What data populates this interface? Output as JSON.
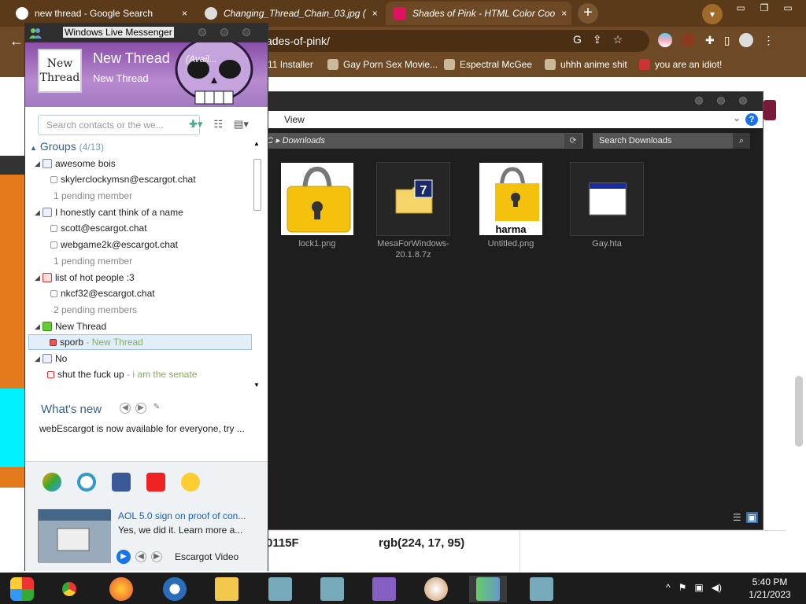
{
  "chrome": {
    "tabs": [
      {
        "title": "new thread - Google Search",
        "close": "×"
      },
      {
        "title": "Changing_Thread_Chain_03.jpg (",
        "close": "×"
      },
      {
        "title": "Shades of Pink - HTML Color Coo",
        "close": "×"
      }
    ],
    "new_tab": "+",
    "url": "ades-of-pink/",
    "bookmarks": [
      "11 Installer",
      "Gay Porn Sex Movie...",
      "Espectral McGee",
      "uhhh anime shit",
      "you are an idiot!"
    ]
  },
  "page": {
    "hex_value": "0115F",
    "rgb_value": "rgb(224, 17, 95)"
  },
  "explorer": {
    "menu_view": "View",
    "address": "C ▸ Downloads",
    "search_placeholder": "Search Downloads",
    "help": "?",
    "files": [
      {
        "name": "lock1.png"
      },
      {
        "name": "MesaForWindows-20.1.8.7z"
      },
      {
        "name": "Untitled.png",
        "thumb_text": "harma"
      },
      {
        "name": "Gay.hta"
      }
    ]
  },
  "messenger": {
    "window_title": "Windows Live Messenger",
    "avatar_text": "New Thread",
    "display_name": "New Thread",
    "status": "(Avail...",
    "personal_message": "New Thread",
    "search_placeholder": "Search contacts or the we...",
    "groups_label": "Groups",
    "groups_count": "(4/13)",
    "list": [
      {
        "type": "group",
        "label": "awesome bois"
      },
      {
        "type": "contact",
        "label": "skylerclockymsn@escargot.chat"
      },
      {
        "type": "pending",
        "label": "1 pending member"
      },
      {
        "type": "group",
        "label": "I honestly cant think of a name"
      },
      {
        "type": "contact",
        "label": "scott@escargot.chat"
      },
      {
        "type": "contact",
        "label": "webgame2k@escargot.chat"
      },
      {
        "type": "pending",
        "label": "1 pending member"
      },
      {
        "type": "group",
        "label": "list of hot people :3"
      },
      {
        "type": "contact",
        "label": "nkcf32@escargot.chat"
      },
      {
        "type": "pending",
        "label": "2 pending members"
      },
      {
        "type": "group",
        "label": "New Thread"
      },
      {
        "type": "contact",
        "label": "sporb",
        "psm": "New Thread"
      },
      {
        "type": "group",
        "label": "No"
      },
      {
        "type": "contact",
        "label": "shut the fuck up",
        "psm": "i am the senate"
      }
    ],
    "whats_new_title": "What's new",
    "whats_new_text": "webEscargot is now available for everyone, try ...",
    "video": {
      "title": "AOL 5.0 sign on proof of con...",
      "desc": "Yes, we did it. Learn more a...",
      "source": "Escargot Video"
    }
  },
  "taskbar": {
    "time": "5:40 PM",
    "date": "1/21/2023"
  },
  "colors": {
    "chrome_bg": "#6d4a25",
    "accent_pink": "#e0115f",
    "wlm_header": "#8a4fa8"
  }
}
